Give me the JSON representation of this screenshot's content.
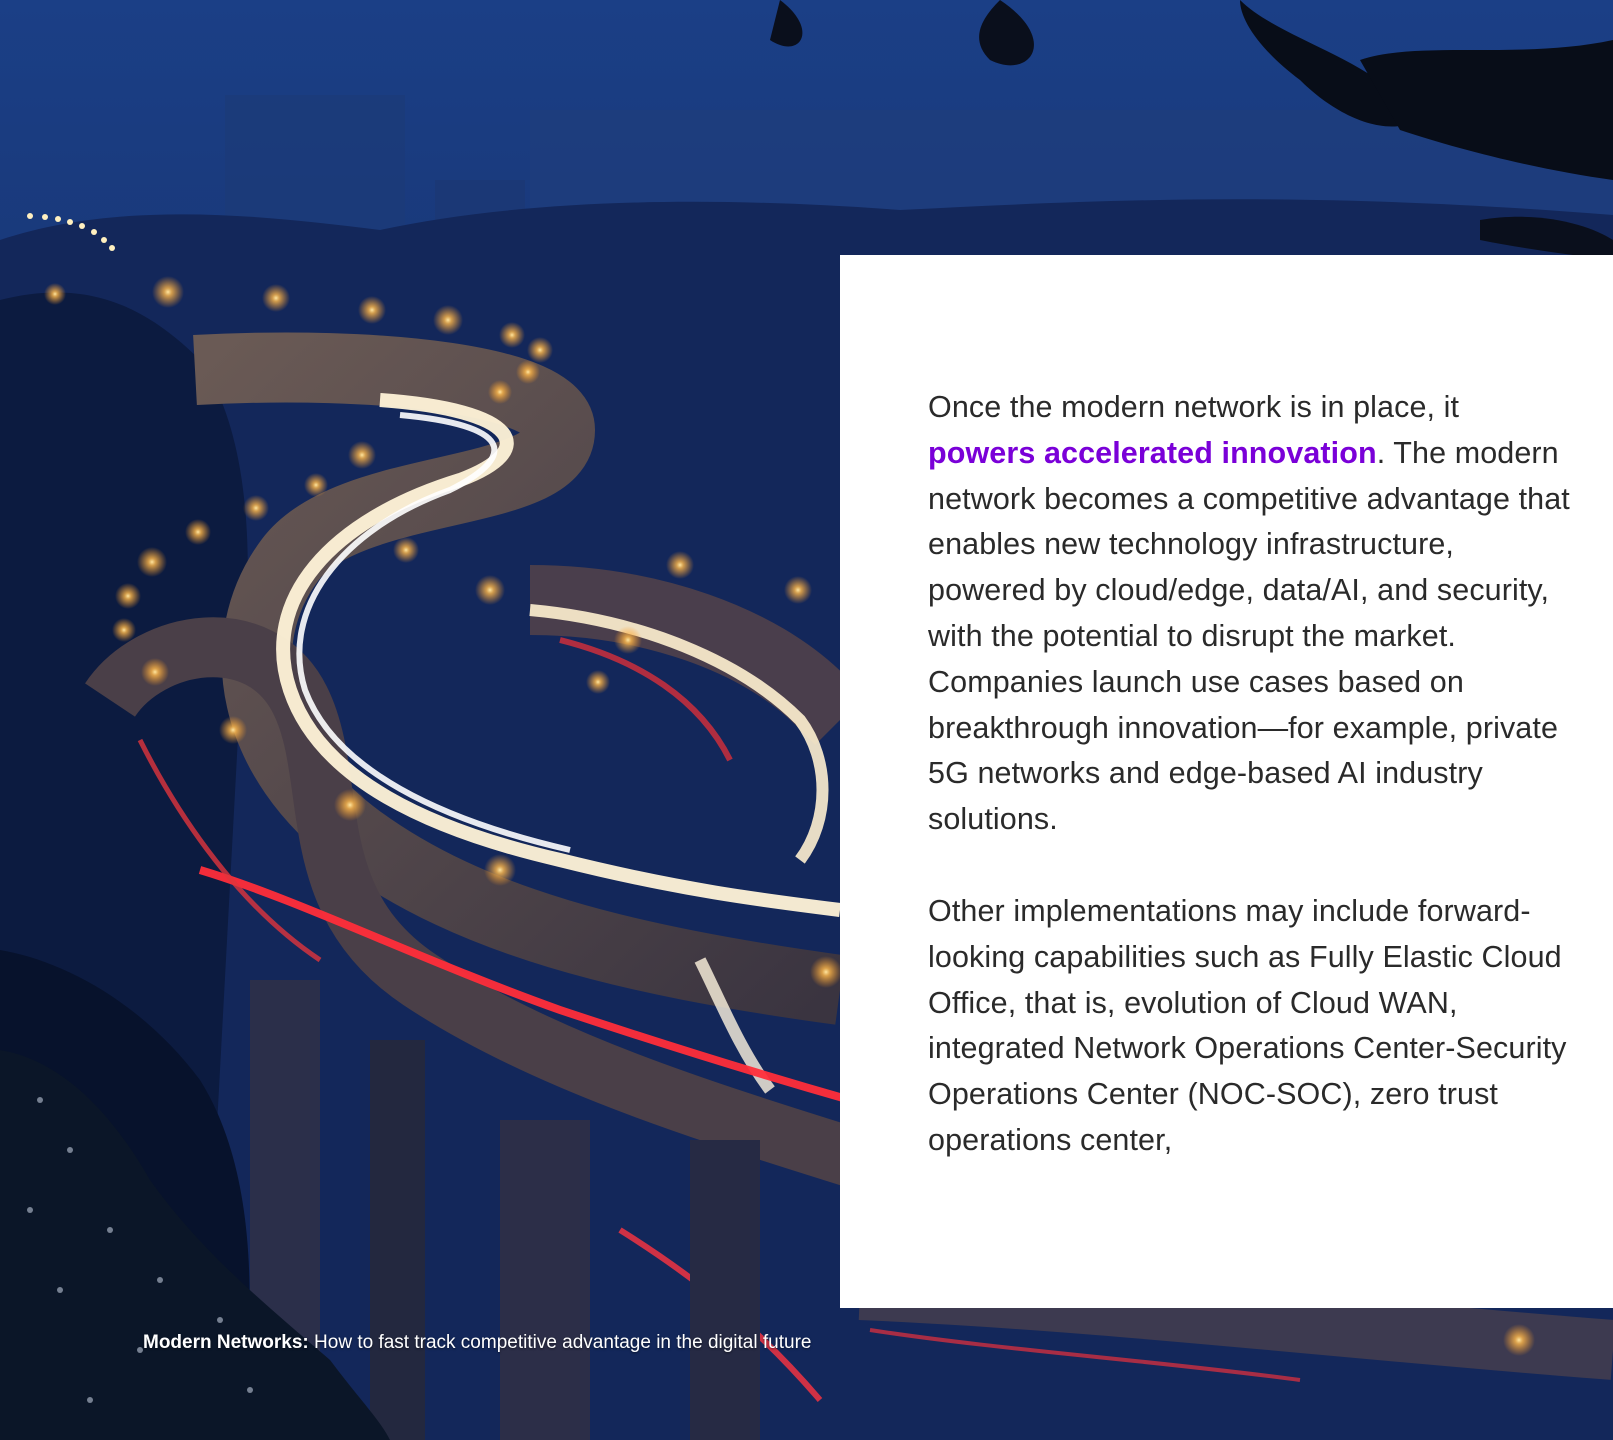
{
  "page": {
    "background_photo": "night-highway-light-trails-photo"
  },
  "card": {
    "paragraph1": {
      "before": "Once the modern network is in place, it ",
      "highlight": "powers accelerated innovation",
      "after": ". The modern network becomes a competitive advantage that enables new technology infrastructure, powered by cloud/edge, data/AI, and security, with the potential to disrupt the market. Companies launch use cases based on breakthrough innovation—for example, private 5G networks and edge-based AI industry solutions."
    },
    "paragraph2": "Other implementations may include forward-looking capabilities such as Fully Elastic Cloud Office, that is, evolution of Cloud WAN, integrated Network Operations Center-Security Operations Center (NOC-SOC), zero trust operations center,"
  },
  "footer": {
    "bold": "Modern Networks:",
    "rest": " How to fast track competitive advantage in the digital future"
  },
  "colors": {
    "highlight": "#7a00d8",
    "body_text": "#2a2a2a",
    "card_bg": "#ffffff",
    "sky": "#1a3a7a"
  }
}
